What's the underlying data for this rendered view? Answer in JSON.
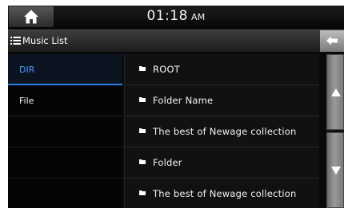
{
  "status_bar": {
    "time": "01:18",
    "ampm": "AM",
    "home_icon": "home-icon"
  },
  "title_bar": {
    "icon": "list-icon",
    "title": "Music List",
    "back_icon": "back-arrow-icon"
  },
  "tabs": [
    {
      "label": "DIR",
      "active": true
    },
    {
      "label": "File",
      "active": false
    }
  ],
  "list": {
    "items": [
      {
        "label": "ROOT",
        "icon": "folder-icon"
      },
      {
        "label": "Folder Name",
        "icon": "folder-icon"
      },
      {
        "label": "The best of Newage collection",
        "icon": "folder-icon"
      },
      {
        "label": "Folder",
        "icon": "folder-icon"
      },
      {
        "label": "The best of Newage collection",
        "icon": "folder-icon"
      }
    ]
  },
  "scroll": {
    "up_icon": "scroll-up-icon",
    "down_icon": "scroll-down-icon"
  },
  "colors": {
    "background": "#0a0a0a",
    "active_tab_text": "#4a9cff",
    "active_tab_underline": "#2b7fe0",
    "text": "#f4f4f4"
  }
}
